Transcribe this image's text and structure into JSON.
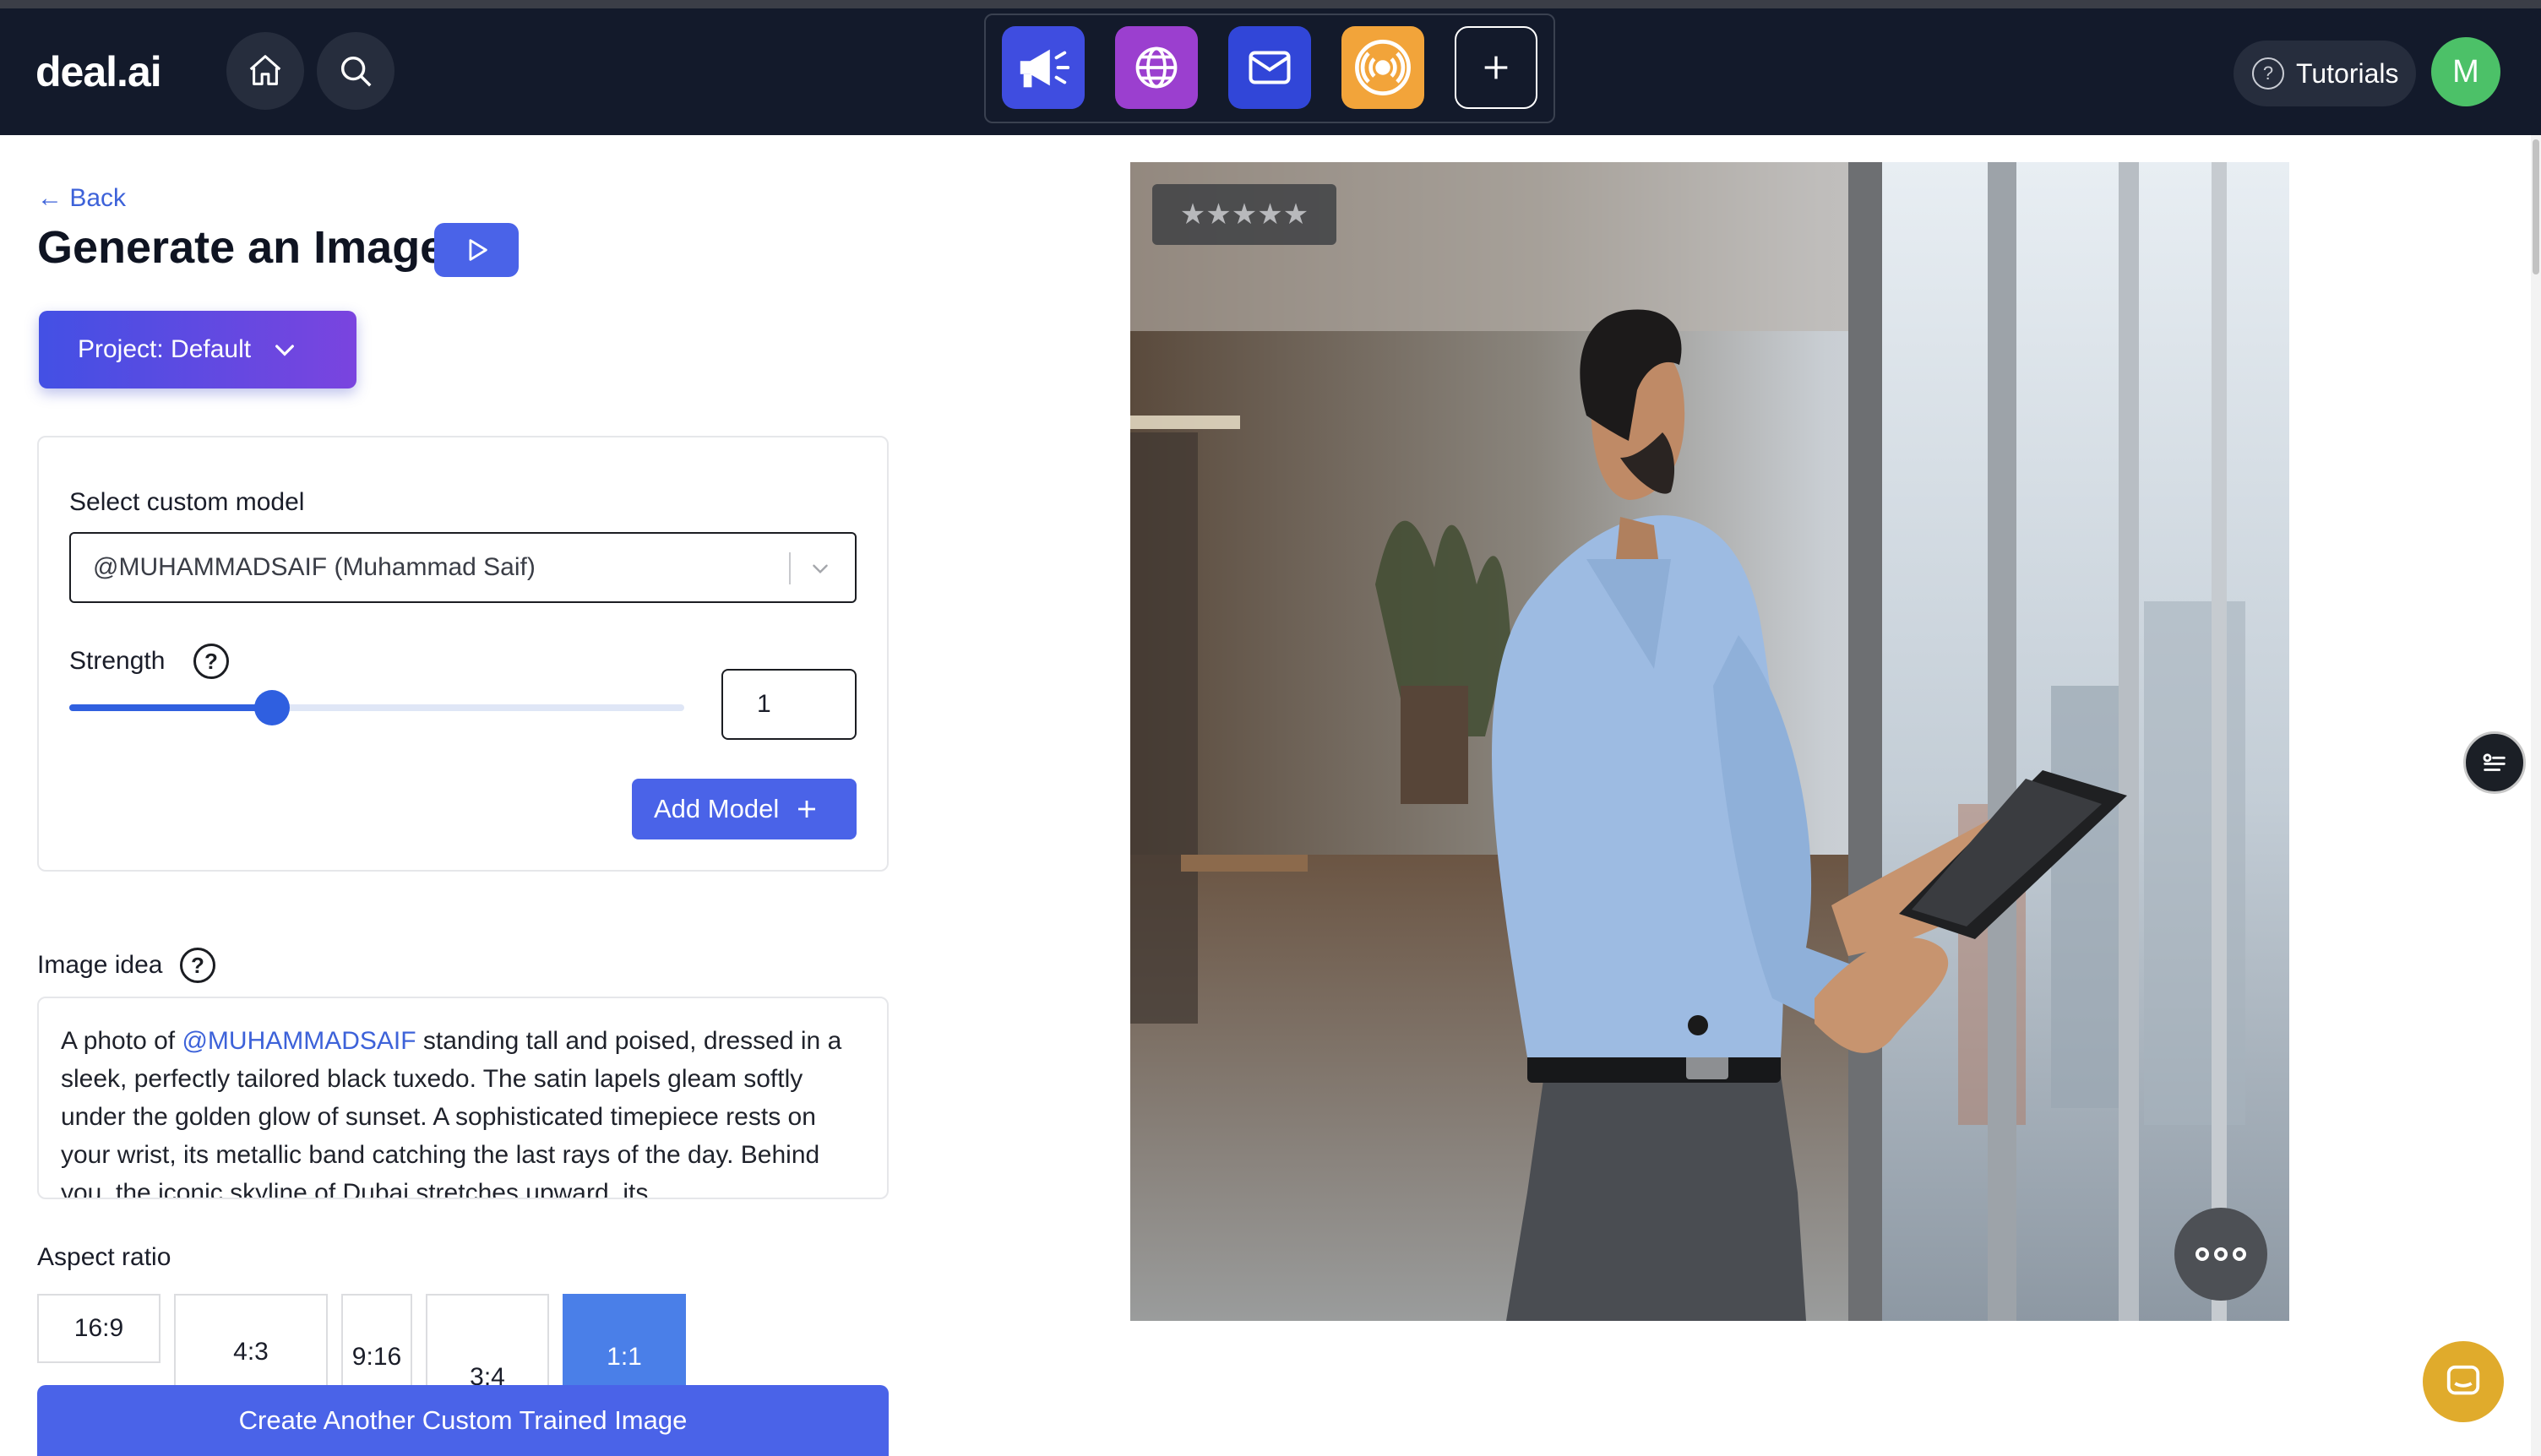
{
  "navbar": {
    "logo": "deal.ai",
    "app_icons": [
      "megaphone-icon",
      "globe-icon",
      "mail-icon",
      "broadcast-icon",
      "plus-icon"
    ],
    "app_colors": [
      "#3f4de0",
      "#9b3fcf",
      "#3146d8",
      "#f2a43a"
    ],
    "tutorials_label": "Tutorials",
    "avatar_letter": "M"
  },
  "page": {
    "back_label": "← Back",
    "title": "Generate an Image",
    "project_label": "Project: Default"
  },
  "model": {
    "label": "Select custom model",
    "selected": "@MUHAMMADSAIF (Muhammad Saif)",
    "strength_label": "Strength",
    "strength_help": "?",
    "strength_value": "1",
    "strength_fraction": 0.33,
    "add_model_label": "Add Model"
  },
  "idea": {
    "label": "Image idea",
    "help": "?",
    "prefix": "A photo of ",
    "mention": "@MUHAMMADSAIF",
    "text": " standing tall and poised, dressed in a sleek, perfectly tailored black tuxedo. The satin lapels gleam softly under the golden glow of sunset. A sophisticated timepiece rests on your wrist, its metallic band catching the last rays of the day. Behind you, the iconic skyline of Dubai stretches upward, its"
  },
  "aspect": {
    "label": "Aspect ratio",
    "options": [
      "16:9",
      "4:3",
      "9:16",
      "3:4",
      "1:1"
    ],
    "selected": "1:1"
  },
  "create_label": "Create Another Custom Trained Image",
  "image": {
    "rating_stars": "★★★★★",
    "rating_value": 0
  },
  "colors": {
    "primary": "#4a63e8",
    "navbar": "#131a2b",
    "selected_ratio": "#4a7fe8",
    "avatar": "#4cc168",
    "chat": "#e0ab2c"
  }
}
